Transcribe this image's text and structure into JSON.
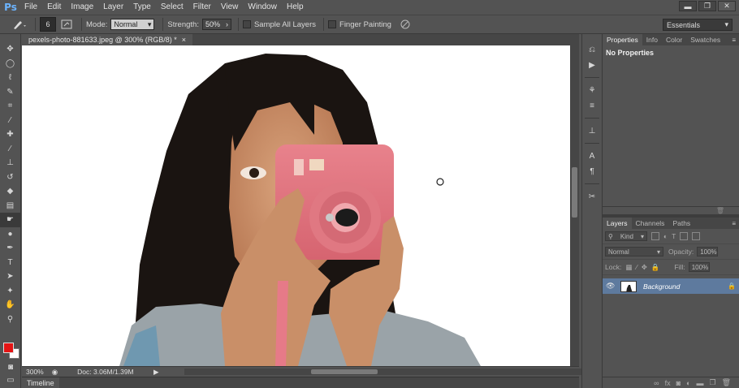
{
  "app": {
    "logo": "Ps"
  },
  "menu": [
    "File",
    "Edit",
    "Image",
    "Layer",
    "Type",
    "Select",
    "Filter",
    "View",
    "Window",
    "Help"
  ],
  "window_controls": {
    "minimize": "▬",
    "restore": "❐",
    "close": "✕"
  },
  "options": {
    "brush_size": "6",
    "mode_label": "Mode:",
    "mode_value": "Normal",
    "strength_label": "Strength:",
    "strength_value": "50%",
    "sample_all_layers": "Sample All Layers",
    "finger_painting": "Finger Painting",
    "workspace": "Essentials"
  },
  "document": {
    "tab_title": "pexels-photo-881633.jpeg @ 300% (RGB/8) *",
    "tab_close": "×",
    "zoom": "300%",
    "doc_info": "Doc: 3.06M/1.39M"
  },
  "timeline": {
    "label": "Timeline"
  },
  "properties_panel": {
    "tabs": [
      "Properties",
      "Info",
      "Color",
      "Swatches"
    ],
    "active_tab": "Properties",
    "message": "No Properties"
  },
  "layers_panel": {
    "tabs": [
      "Layers",
      "Channels",
      "Paths"
    ],
    "active_tab": "Layers",
    "kind_label": "Kind",
    "blend_mode": "Normal",
    "opacity_label": "Opacity:",
    "opacity_value": "100%",
    "lock_label": "Lock:",
    "fill_label": "Fill:",
    "fill_value": "100%",
    "layers": [
      {
        "name": "Background",
        "visible": true,
        "locked": true
      }
    ]
  },
  "colors": {
    "foreground": "#e41414",
    "background": "#ffffff",
    "panel": "#535353",
    "selected_layer": "#5e7a9e"
  },
  "icons": {
    "toolbox": [
      "move-icon",
      "marquee-icon",
      "lasso-icon",
      "quick-select-icon",
      "crop-icon",
      "eyedropper-icon",
      "spot-healing-icon",
      "brush-icon",
      "clone-stamp-icon",
      "history-brush-icon",
      "eraser-icon",
      "gradient-icon",
      "smudge-icon",
      "dodge-icon",
      "pen-icon",
      "type-icon",
      "path-select-icon",
      "shape-icon",
      "hand-icon",
      "zoom-icon"
    ]
  }
}
